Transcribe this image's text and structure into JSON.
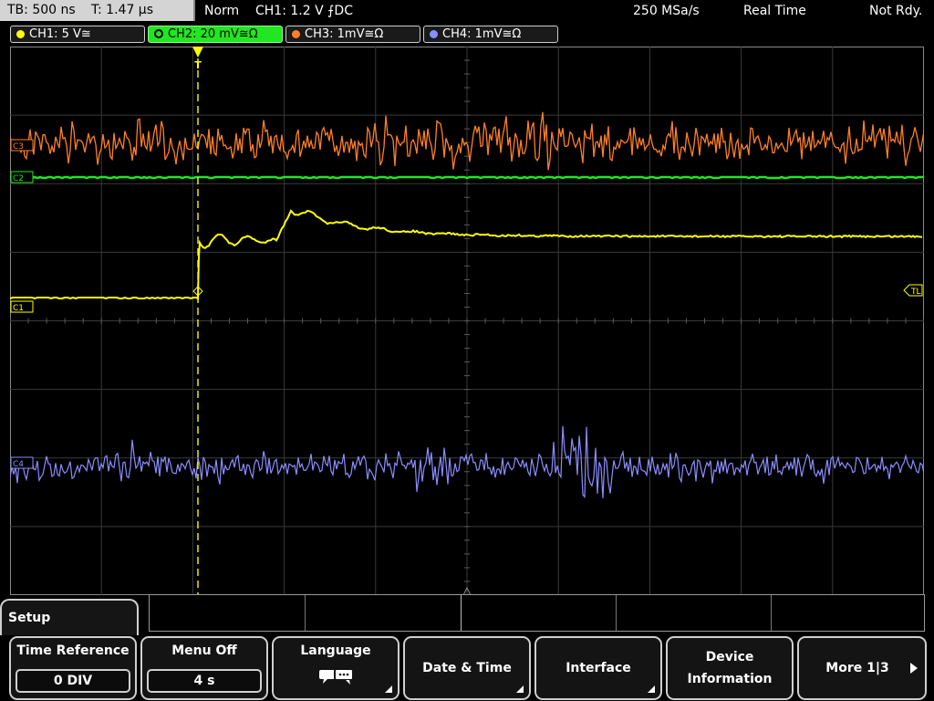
{
  "topbar": {
    "timebase": "TB: 500 ns",
    "trigger_time": "T: 1.47 µs",
    "trigger_mode": "Norm",
    "trigger_info": "CH1: 1.2 V ⨍DC",
    "sample_rate": "250 MSa/s",
    "acq_mode": "Real Time",
    "status": "Not Rdy."
  },
  "channels": [
    {
      "label": "CH1: 5 V≅",
      "color": "#ffff00"
    },
    {
      "label": "CH2: 20 mV≅Ω",
      "color": "#22e622"
    },
    {
      "label": "CH3: 1mV≅Ω",
      "color": "#ff7f27"
    },
    {
      "label": "CH4: 1mV≅Ω",
      "color": "#8c8cff"
    }
  ],
  "markers": {
    "ch1": "C1",
    "ch2": "C2",
    "ch3": "C3",
    "ch4": "C4",
    "trigger_level": "TL",
    "trigger_position": "T"
  },
  "menu": {
    "title": "Setup",
    "time_reference_label": "Time Reference",
    "time_reference_value": "0 DIV",
    "menu_off_label": "Menu Off",
    "menu_off_value": "4 s",
    "language_label": "Language",
    "language_icon": "speech-bubble-icon",
    "date_time_label": "Date & Time",
    "interface_label": "Interface",
    "device_info_line1": "Device",
    "device_info_line2": "Information",
    "more_label": "More 1|3"
  }
}
